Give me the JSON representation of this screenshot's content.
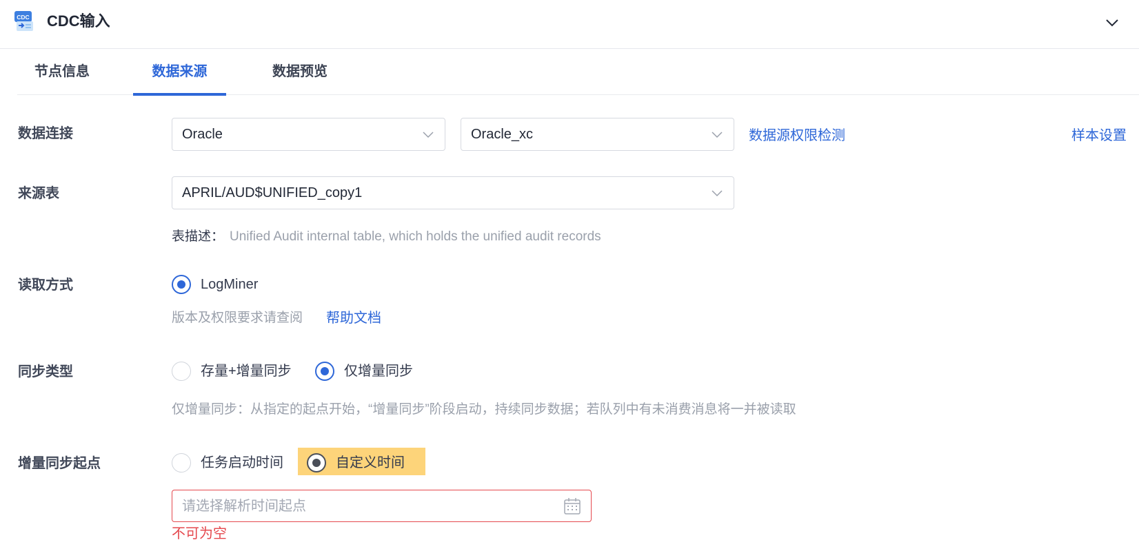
{
  "header": {
    "logo_text": "CDC",
    "title": "CDC输入",
    "collapse_icon": "chevron-down-icon"
  },
  "tabs": [
    {
      "label": "节点信息",
      "active": false
    },
    {
      "label": "数据来源",
      "active": true
    },
    {
      "label": "数据预览",
      "active": false
    }
  ],
  "form": {
    "connection": {
      "label": "数据连接",
      "db_type": "Oracle",
      "connection_name": "Oracle_xc",
      "check_link": "数据源权限检测",
      "sample_link": "样本设置"
    },
    "source_table": {
      "label": "来源表",
      "value": "APRIL/AUD$UNIFIED_copy1",
      "desc_label": "表描述：",
      "desc_text": "Unified Audit internal table, which holds the unified audit records"
    },
    "read_mode": {
      "label": "读取方式",
      "option": "LogMiner",
      "hint": "版本及权限要求请查阅",
      "help_link": "帮助文档"
    },
    "sync_type": {
      "label": "同步类型",
      "options": [
        "存量+增量同步",
        "仅增量同步"
      ],
      "selected": "仅增量同步",
      "hint": "仅增量同步：从指定的起点开始，“增量同步”阶段启动，持续同步数据；若队列中有未消费消息将一并被读取"
    },
    "incr_start": {
      "label": "增量同步起点",
      "options": [
        "任务启动时间",
        "自定义时间"
      ],
      "selected": "自定义时间",
      "input_value": "",
      "input_placeholder": "请选择解析时间起点",
      "error": "不可为空"
    }
  },
  "colors": {
    "accent": "#2e67d8",
    "error": "#e5484d",
    "highlight": "#fdd47a"
  }
}
